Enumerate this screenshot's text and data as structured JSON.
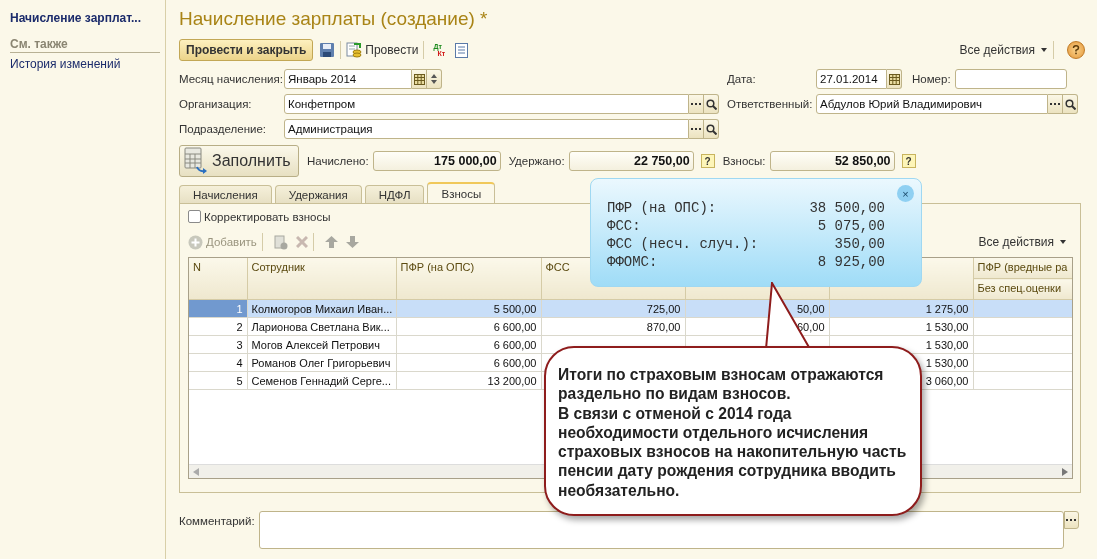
{
  "sidebar": {
    "title": "Начисление зарплат...",
    "section": "См. также",
    "links": [
      "История изменений"
    ]
  },
  "document": {
    "title": "Начисление зарплаты (создание) *"
  },
  "toolbar": {
    "post_close": "Провести и закрыть",
    "post": "Провести",
    "dt": "Дт",
    "kt": "Кт",
    "all_actions": "Все действия"
  },
  "fields": {
    "month": {
      "label": "Месяц начисления:",
      "value": "Январь 2014"
    },
    "date": {
      "label": "Дата:",
      "value": "27.01.2014"
    },
    "number": {
      "label": "Номер:"
    },
    "organization": {
      "label": "Организация:",
      "value": "Конфетпром"
    },
    "responsible": {
      "label": "Ответственный:",
      "value": "Абдулов Юрий Владимирович"
    },
    "department": {
      "label": "Подразделение:",
      "value": "Администрация"
    }
  },
  "fill_button": "Заполнить",
  "totals": [
    {
      "label": "Начислено:",
      "value": "175 000,00"
    },
    {
      "label": "Удержано:",
      "value": "22 750,00",
      "hint": "?"
    },
    {
      "label": "Взносы:",
      "value": "52 850,00",
      "hint": "?"
    }
  ],
  "tabs": [
    {
      "label": "Начисления",
      "selected": false
    },
    {
      "label": "Удержания",
      "selected": false
    },
    {
      "label": "НДФЛ",
      "selected": false
    },
    {
      "label": "Взносы",
      "selected": true
    }
  ],
  "correct_contributions": {
    "label": "Корректировать взносы",
    "checked": false
  },
  "table_toolbar": {
    "add": "Добавить",
    "disabled": true,
    "all_actions": "Все действия"
  },
  "table": {
    "columns": [
      {
        "label": "N"
      },
      {
        "label": "Сотрудник"
      },
      {
        "label": "ПФР (на ОПС)"
      },
      {
        "label": "ФСС"
      },
      {},
      {},
      {
        "label": "ПФР (вредные ра",
        "sublabel": "Без спец.оценки"
      }
    ],
    "rows": [
      {
        "selected": true,
        "cells": [
          "1",
          "Колмогоров Михаил Иван...",
          "5 500,00",
          "725,00",
          "50,00",
          "1 275,00",
          null
        ]
      },
      {
        "selected": false,
        "cells": [
          "2",
          "Ларионова Светлана Вик...",
          "6 600,00",
          "870,00",
          "60,00",
          "1 530,00",
          null
        ]
      },
      {
        "selected": false,
        "cells": [
          "3",
          "Могов Алексей Петрович",
          "6 600,00",
          null,
          null,
          "1 530,00",
          null
        ]
      },
      {
        "selected": false,
        "cells": [
          "4",
          "Романов Олег Григорьевич",
          "6 600,00",
          null,
          null,
          "1 530,00",
          null
        ]
      },
      {
        "selected": false,
        "cells": [
          "5",
          "Семенов Геннадий Серге...",
          "13 200,00",
          null,
          null,
          "3 060,00",
          null
        ]
      }
    ]
  },
  "summary_popup": {
    "close": "×",
    "lines": [
      {
        "label": "ПФР (на ОПС):",
        "value": "38 500,00"
      },
      {
        "label": "ФСС:",
        "value": "5 075,00"
      },
      {
        "label": "ФСС (несч. случ.):",
        "value": "350,00"
      },
      {
        "label": "ФФОМС:",
        "value": "8 925,00"
      }
    ]
  },
  "callout": {
    "paragraphs": [
      "Итоги по страховым взносам отражаются раздельно по видам взносов.",
      "В связи с отменой с 2014 года необходимости отдельного исчисления страховых взносов на накопительную часть пенсии дату рождения сотрудника вводить необязательно."
    ]
  },
  "comment": {
    "label": "Комментарий:"
  }
}
